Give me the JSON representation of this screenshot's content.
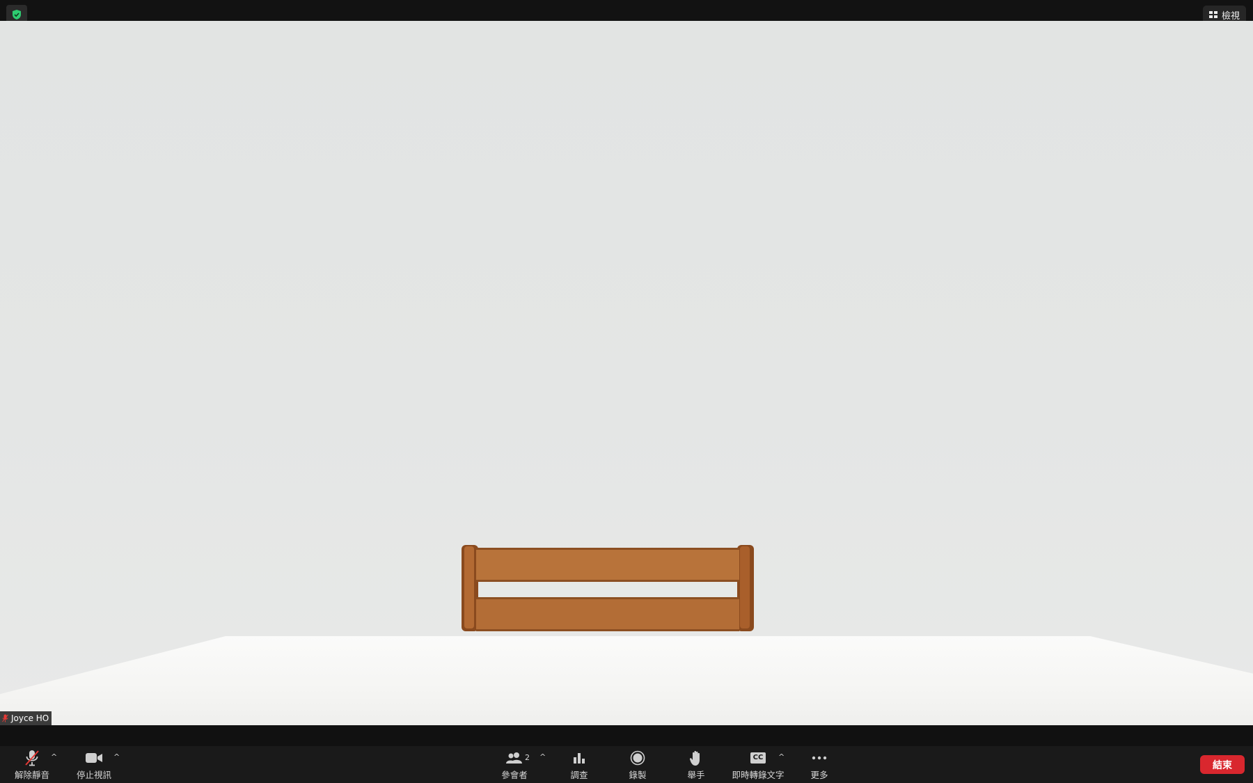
{
  "topbar": {
    "view_label": "檢視"
  },
  "video": {
    "participant_name": "Joyce HO"
  },
  "toolbar": {
    "mute_label": "解除靜音",
    "video_label": "停止視訊",
    "participants_label": "參會者",
    "participants_count": "2",
    "polls_label": "調查",
    "record_label": "錄製",
    "raise_hand_label": "舉手",
    "cc_badge": "CC",
    "captions_label": "即時轉錄文字",
    "more_label": "更多",
    "end_label": "結束",
    "caret": "^"
  },
  "colors": {
    "end_button": "#d9272e",
    "shield": "#2ecc71",
    "toolbar_bg": "#1a1a1a",
    "muted_slash": "#e53935"
  }
}
